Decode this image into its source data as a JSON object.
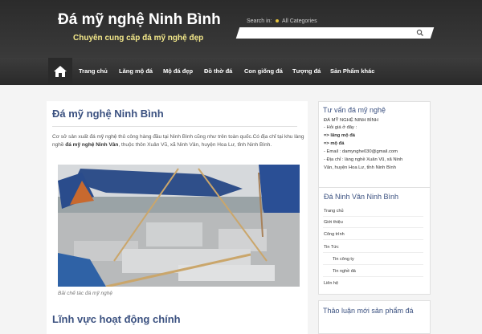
{
  "header": {
    "site_title": "Đá mỹ nghệ Ninh Bình",
    "tagline": "Chuyên cung cấp đá mỹ nghệ đẹp",
    "search_label": "Search in:",
    "category_label": "All Categories",
    "search_value": ""
  },
  "nav": {
    "home_icon": "home-icon",
    "items": [
      {
        "label": "Trang chủ"
      },
      {
        "label": "Lăng mộ đá"
      },
      {
        "label": "Mộ đá đẹp"
      },
      {
        "label": "Đồ thờ đá"
      },
      {
        "label": "Con giống đá"
      },
      {
        "label": "Tượng đá"
      },
      {
        "label": "Sản Phẩm khác"
      }
    ]
  },
  "post": {
    "title": "Đá mỹ nghệ Ninh Bình",
    "intro": "Cơ sở sản xuất đá mỹ nghệ thủ công hàng đầu tại Ninh Bình cũng như trên toàn quốc.Có địa chỉ tại khu làng nghề ",
    "intro_bold": "đá mỹ nghệ Ninh Vân",
    "intro_rest": ", thuộc thôn Xuân Vũ, xã Ninh Vân, huyện Hoa Lư, tỉnh Ninh Bình.",
    "caption": "Bãi chế tác đá mỹ nghệ",
    "section_heading": "Lĩnh vực hoạt động chính"
  },
  "sidebar": {
    "widget1": {
      "title": "Tư vấn đá mỹ nghệ",
      "lines": [
        "ĐÁ MỸ NGHỆ NINH BÌNH",
        "- Hỏi giá ở đây :",
        "=>   lăng mộ đá",
        "=>   mộ đá",
        "- Email : damynghe030@gmail.com",
        "- Địa chỉ : làng nghề Xuân Vũ, xã Ninh",
        "Vân, huyện Hoa Lư, tỉnh Ninh Bình"
      ]
    },
    "widget2": {
      "title": "Đá Ninh Vân Ninh Bình",
      "items": [
        {
          "label": "Trang chủ"
        },
        {
          "label": "Giới thiệu"
        },
        {
          "label": "Công trình"
        },
        {
          "label": "Tin Tức"
        },
        {
          "label": "Tin công ty"
        },
        {
          "label": "Tin nghề đá"
        },
        {
          "label": "Liên hệ"
        }
      ]
    },
    "widget3": {
      "title": "Thảo luận mới sản phẩm đá"
    }
  },
  "colors": {
    "header_bg": "#333333",
    "title_text": "#ffffff",
    "tagline": "#f3e88a",
    "accent_blue": "#3b5180"
  }
}
